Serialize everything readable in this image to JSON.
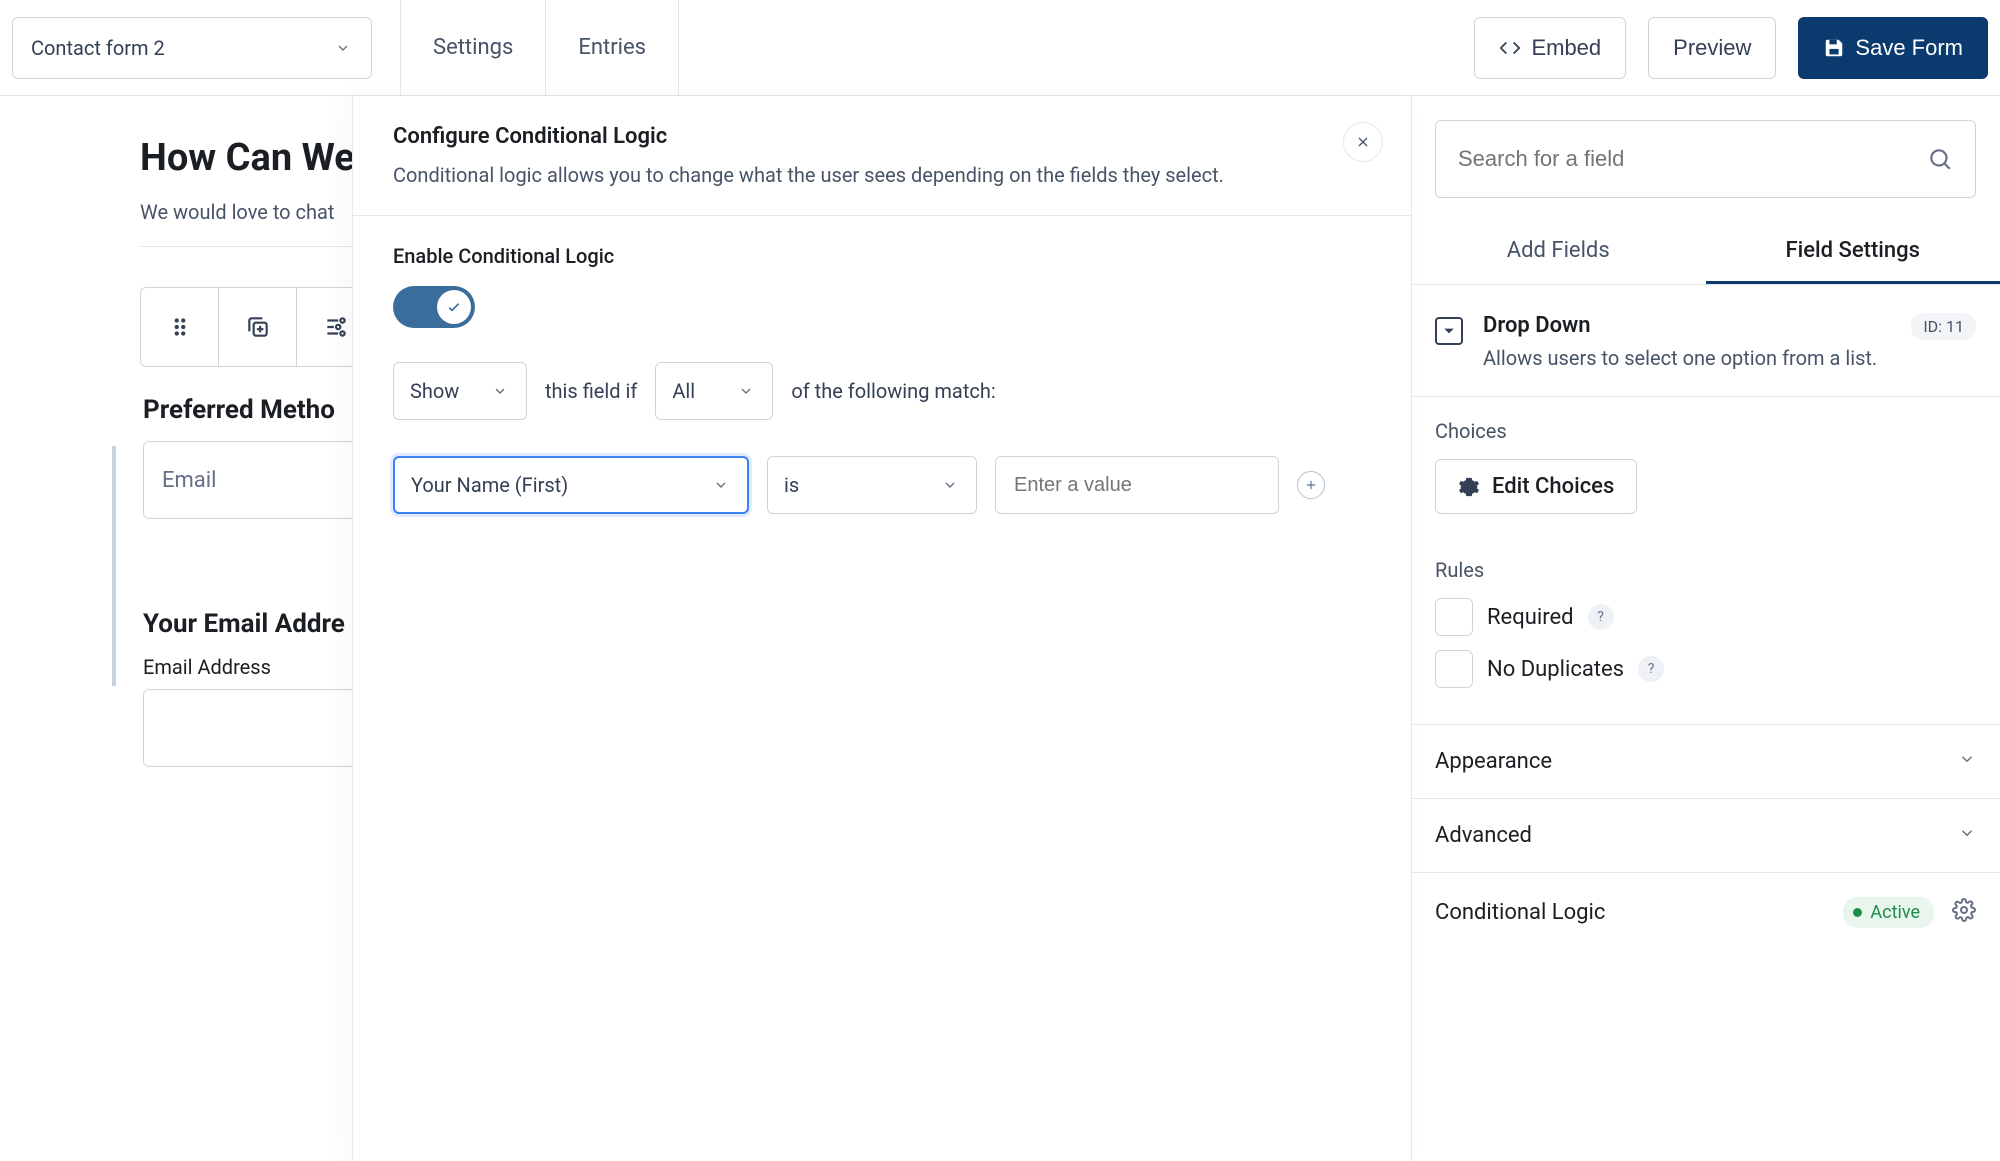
{
  "header": {
    "form_name": "Contact form 2",
    "tabs": {
      "settings": "Settings",
      "entries": "Entries"
    },
    "embed": "Embed",
    "preview": "Preview",
    "save": "Save Form"
  },
  "canvas": {
    "title": "How Can We",
    "subtitle": "We would love to chat",
    "preferred_label": "Preferred Metho",
    "preferred_value": "Email",
    "email_section": "Your Email Addre",
    "email_label": "Email Address"
  },
  "modal": {
    "title": "Configure Conditional Logic",
    "desc": "Conditional logic allows you to change what the user sees depending on the fields they select.",
    "enable_label": "Enable Conditional Logic",
    "show": "Show",
    "text1": "this field if",
    "all": "All",
    "text2": "of the following match:",
    "field": "Your Name (First)",
    "op": "is",
    "val_placeholder": "Enter a value"
  },
  "sidebar": {
    "search_placeholder": "Search for a field",
    "tab_add": "Add Fields",
    "tab_settings": "Field Settings",
    "field_type": "Drop Down",
    "field_desc": "Allows users to select one option from a list.",
    "field_id": "ID: 11",
    "choices_label": "Choices",
    "edit_choices": "Edit Choices",
    "rules_label": "Rules",
    "required": "Required",
    "no_dup": "No Duplicates",
    "appearance": "Appearance",
    "advanced": "Advanced",
    "conditional": "Conditional Logic",
    "active": "Active"
  }
}
